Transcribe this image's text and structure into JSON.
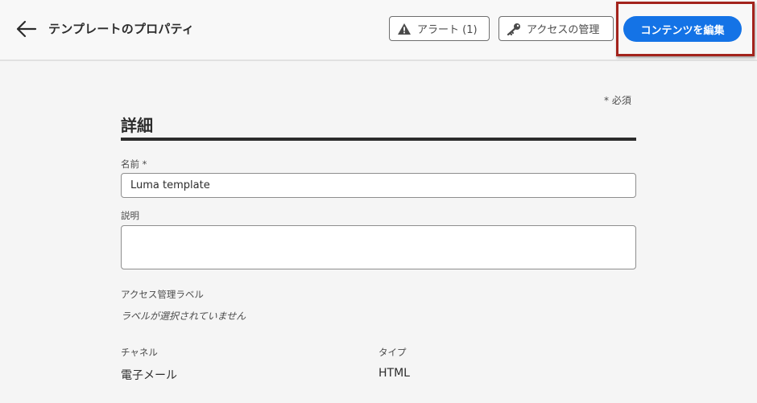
{
  "header": {
    "title": "テンプレートのプロパティ",
    "alert_button": "アラート (1)",
    "access_button": "アクセスの管理",
    "edit_button": "コンテンツを編集"
  },
  "form": {
    "required_note": "* 必須",
    "section_title": "詳細",
    "name_label": "名前 *",
    "name_value": "Luma template",
    "description_label": "説明",
    "description_value": "",
    "access_label": "アクセス管理ラベル",
    "access_value": "ラベルが選択されていません",
    "channel_label": "チャネル",
    "channel_value": "電子メール",
    "type_label": "タイプ",
    "type_value": "HTML"
  },
  "icons": {
    "back": "arrow-left-icon",
    "alert": "warning-icon",
    "access": "key-icon"
  },
  "colors": {
    "primary": "#1473e6",
    "highlight": "#a3231c"
  }
}
